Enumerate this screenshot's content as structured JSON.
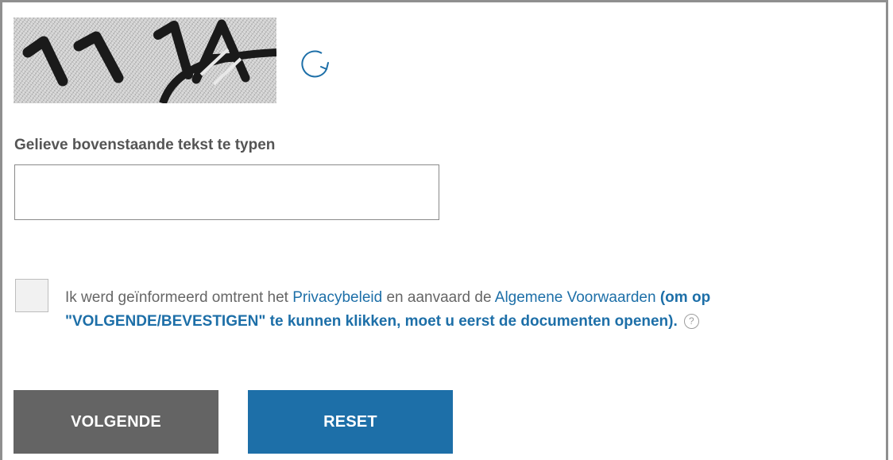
{
  "captcha": {
    "text": "11 1A",
    "refresh_icon": "refresh-icon"
  },
  "form": {
    "label": "Gelieve bovenstaande tekst te typen",
    "input_value": "",
    "input_placeholder": ""
  },
  "consent": {
    "checked": false,
    "text_1": "Ik werd geïnformeerd omtrent het ",
    "link_privacy": "Privacybeleid",
    "text_2": " en aanvaard de ",
    "link_terms": "Algemene Voorwaarden",
    "text_3": " ",
    "bold_note": "(om op \"VOLGENDE/BEVESTIGEN\" te kunnen klikken, moet u eerst de documenten openen).",
    "help_icon": "help-icon"
  },
  "buttons": {
    "next_label": "VOLGENDE",
    "reset_label": "RESET"
  },
  "colors": {
    "accent": "#1d6fa8",
    "next_button": "#646464"
  }
}
